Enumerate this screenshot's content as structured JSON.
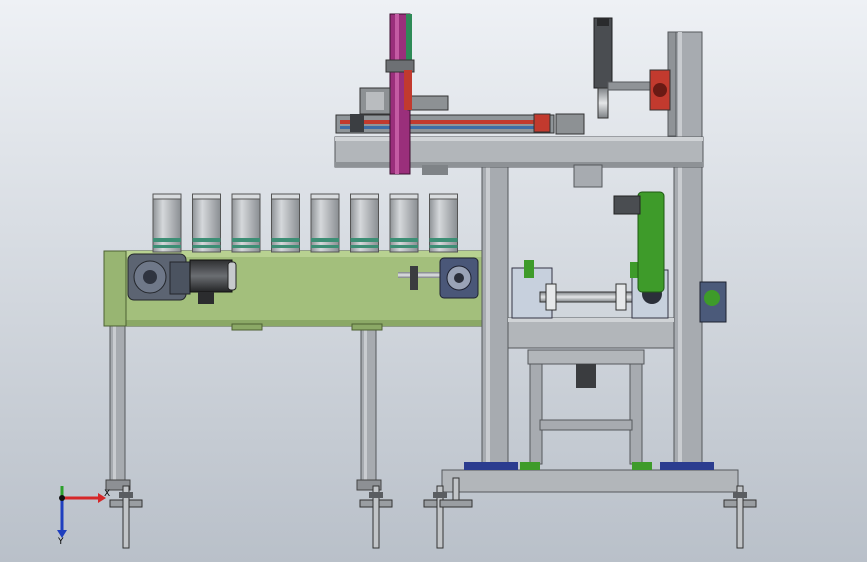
{
  "view": {
    "background_top": "#eef1f5",
    "background_bottom": "#b9c0c9"
  },
  "colors": {
    "frame_gray": "#a7abb0",
    "frame_dark": "#6d7074",
    "conveyor_green": "#a3bf7c",
    "conveyor_green_dark": "#5f7a3f",
    "can_gray": "#b0b4b8",
    "can_band": "#3d8e75",
    "magenta": "#9a2f7b",
    "red_accent": "#c23a2e",
    "blue_pad": "#2b3c8f",
    "gearbox_blue": "#4b5a7a",
    "bright_green": "#3e9b2a"
  },
  "triad": {
    "x_label": "X",
    "y_label": "Y",
    "x_color": "#d62728",
    "y_color": "#2ca02c",
    "z_color": "#1f3fbf",
    "origin_icon": "coordinate-triad-icon"
  },
  "assembly": {
    "can_count": 8,
    "foot_count": 5
  }
}
